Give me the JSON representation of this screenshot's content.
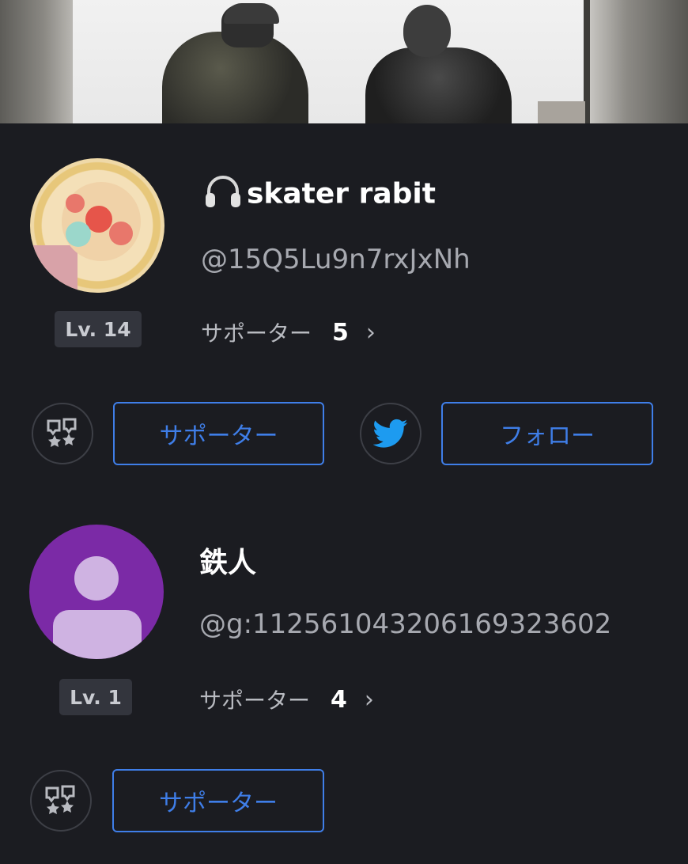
{
  "users": [
    {
      "name": "skater rabit",
      "name_icon": "headphones-icon",
      "handle": "@15Q5Lu9n7rxJxNh",
      "level": "Lv. 14",
      "supporter_label": "サポーター",
      "supporter_count": "5",
      "support_button": "サポーター",
      "follow_button": "フォロー",
      "has_twitter": true
    },
    {
      "name": "鉄人",
      "handle": "@g:112561043206169323602",
      "level": "Lv. 1",
      "supporter_label": "サポーター",
      "supporter_count": "4",
      "support_button": "サポーター",
      "has_twitter": false
    }
  ],
  "colors": {
    "background": "#1b1c21",
    "accent": "#3f7ee8",
    "twitter": "#1d9bf0",
    "avatar_purple": "#7b2aa6"
  }
}
